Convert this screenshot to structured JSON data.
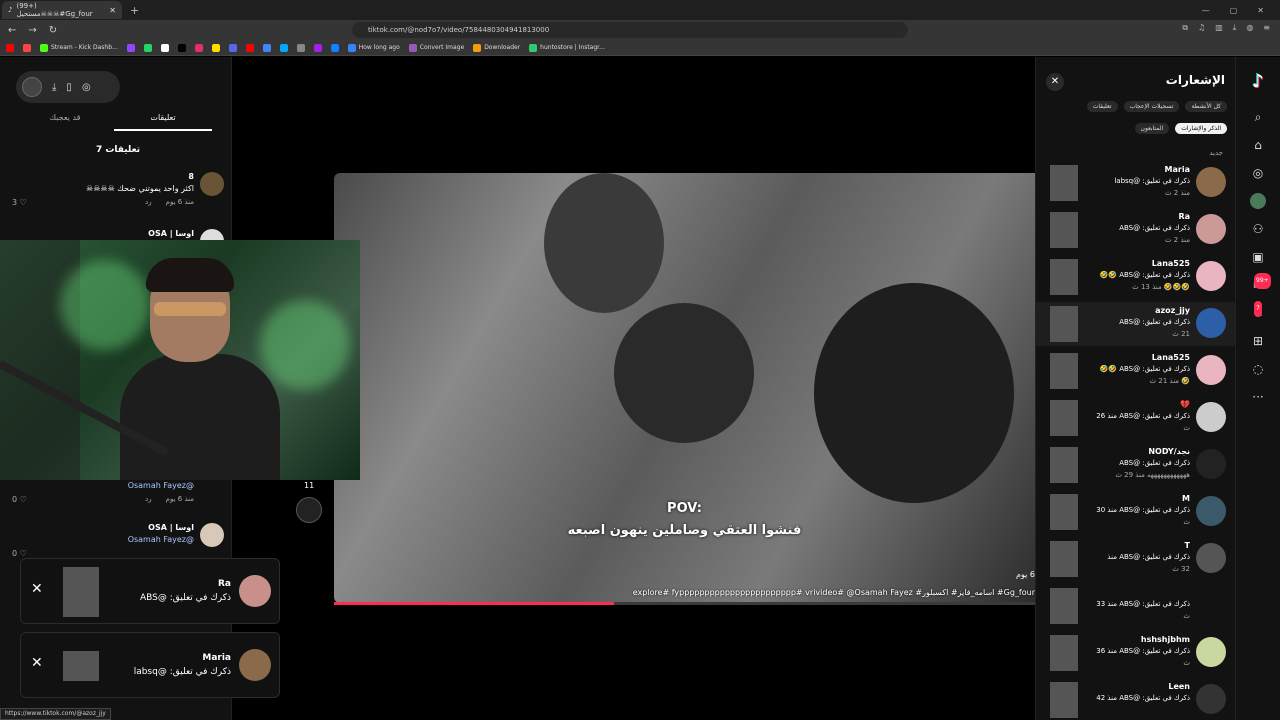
{
  "browser": {
    "tab_title": "(99+) مستحيل☠☠☠#Gg_four",
    "url": "tiktok.com/@nod7o7/video/7584480304941813000",
    "bookmarks": [
      {
        "label": "",
        "color": "#ff0000"
      },
      {
        "label": "",
        "color": "#ff4444"
      },
      {
        "label": "Stream - Kick Dashb...",
        "color": "#53fc18"
      },
      {
        "label": "",
        "color": "#9146ff"
      },
      {
        "label": "",
        "color": "#25d366"
      },
      {
        "label": "",
        "color": "#ffffff"
      },
      {
        "label": "",
        "color": "#000000"
      },
      {
        "label": "",
        "color": "#e1306c"
      },
      {
        "label": "",
        "color": "#ffdd00"
      },
      {
        "label": "",
        "color": "#5865f2"
      },
      {
        "label": "",
        "color": "#ff0000"
      },
      {
        "label": "",
        "color": "#4285f4"
      },
      {
        "label": "",
        "color": "#00a8ff"
      },
      {
        "label": "",
        "color": "#888888"
      },
      {
        "label": "",
        "color": "#a020f0"
      },
      {
        "label": "",
        "color": "#0a84ff"
      },
      {
        "label": "How long ago",
        "color": "#3b82f6"
      },
      {
        "label": "Convert Image",
        "color": "#9b59b6"
      },
      {
        "label": "Downloader",
        "color": "#f39c12"
      },
      {
        "label": "huntostore | Instagr...",
        "color": "#2ecc71"
      }
    ],
    "ext_badge": "1",
    "status_url": "https://www.tiktok.com/@azoz_jjy"
  },
  "left": {
    "tabs": {
      "comments": "تعليقات",
      "you_may_like": "قد يعجبك"
    },
    "comments_count": "7 تعليقات",
    "comments": [
      {
        "name": "8",
        "text": "اكثر واحد يموتني ضحك ☠☠☠☠",
        "time": "منذ 6 يوم",
        "reply": "رد",
        "likes": "3",
        "mention": ""
      },
      {
        "name": "اوسا | OSA",
        "text": "",
        "time": "",
        "reply": "",
        "likes": "",
        "mention": ""
      },
      {
        "name": "",
        "text": "",
        "time": "منذ 6 يوم",
        "reply": "رد",
        "likes": "0",
        "mention": "@Osamah Fayez"
      },
      {
        "name": "اوسا | OSA",
        "text": "",
        "time": "",
        "reply": "",
        "likes": "0",
        "mention": "@Osamah Fayez"
      }
    ]
  },
  "toasts": [
    {
      "name": "Ra",
      "text": "ذكرك في تعليق: @ABS"
    },
    {
      "name": "Maria",
      "text": "ذكرك في تعليق: @labsq"
    }
  ],
  "video": {
    "caption_1": "POV:",
    "caption_2": "فنشوا العتقي وصاملين ينهون اصبعه",
    "time": "6 يوم",
    "desc": "Gg_four# اسامه_فايز# اكسبلور# explore# fyppppppppppppppppppppppp# vrivideo# @Osamah Fayez",
    "side_count": "11",
    "progress": 0.4
  },
  "notifications": {
    "title": "الإشعارات",
    "filters": [
      "كل الأنشطة",
      "تسجيلات الإعجاب",
      "تعليقات",
      "الذكر والإشارات",
      "المتابعون"
    ],
    "active_filter": 3,
    "new_label": "جديد",
    "items": [
      {
        "name": "Maria",
        "text": "ذكرك في تعليق: @labsq",
        "time": "منذ 2 ث",
        "avatar": "#8a6a4a"
      },
      {
        "name": "Ra",
        "text": "ذكرك في تعليق: @ABS",
        "time": "منذ 2 ث",
        "avatar": "#c99"
      },
      {
        "name": "Lana525",
        "text": "ذكرك في تعليق: @ABS 🤣🤣",
        "time": "🤣🤣🤣 منذ 13 ث",
        "avatar": "#e8b5c0"
      },
      {
        "name": "azoz_jjy",
        "text": "ذكرك في تعليق: @ABS",
        "time": "21 ث",
        "avatar": "#2c5fa8"
      },
      {
        "name": "Lana525",
        "text": "ذكرك في تعليق: @ABS 🤣🤣",
        "time": "🤣 منذ 21 ث",
        "avatar": "#e8b5c0"
      },
      {
        "name": "💔",
        "text": "ذكرك في تعليق: @ABS منذ 26",
        "time": "ث",
        "avatar": "#ccc"
      },
      {
        "name": "نجد/NODY",
        "text": "ذكرك في تعليق: @ABS",
        "time": "ههههههههههههه منذ 29 ث",
        "avatar": "#222"
      },
      {
        "name": "M",
        "text": "ذكرك في تعليق: @ABS منذ 30",
        "time": "ث",
        "avatar": "#3a5a6a"
      },
      {
        "name": "T",
        "text": "ذكرك في تعليق: @ABS منذ",
        "time": "32 ث",
        "avatar": "#555"
      },
      {
        "name": "",
        "text": "ذكرك في تعليق: @ABS منذ 33",
        "time": "ث",
        "avatar": "#121212"
      },
      {
        "name": "hshshjbhm",
        "text": "ذكرك في تعليق: @ABS منذ 36",
        "time": "ث",
        "avatar": "#c8d8a0"
      },
      {
        "name": "Leen",
        "text": "ذكرك في تعليق: @ABS منذ 42",
        "time": "",
        "avatar": "#333"
      }
    ]
  },
  "tiktok_nav": {
    "messages_badge": "99+",
    "inbox_badge": "7"
  }
}
